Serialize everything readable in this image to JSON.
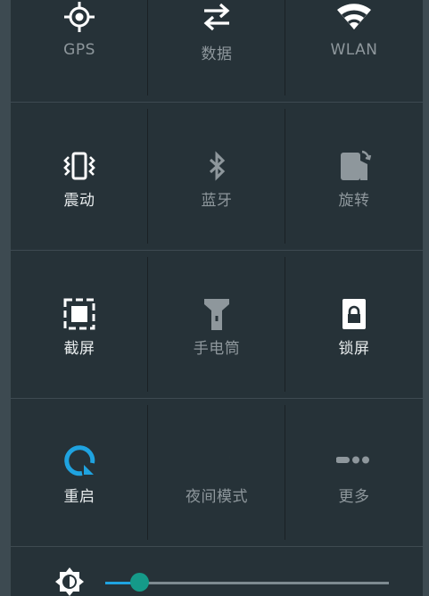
{
  "quick_settings": {
    "rows": [
      [
        {
          "label": "GPS",
          "icon": "gps-icon",
          "state": "off"
        },
        {
          "label": "数据",
          "icon": "data-transfer-icon",
          "state": "off"
        },
        {
          "label": "WLAN",
          "icon": "wifi-icon",
          "state": "off"
        }
      ],
      [
        {
          "label": "震动",
          "icon": "vibrate-icon",
          "state": "on"
        },
        {
          "label": "蓝牙",
          "icon": "bluetooth-icon",
          "state": "off"
        },
        {
          "label": "旋转",
          "icon": "rotate-icon",
          "state": "off"
        }
      ],
      [
        {
          "label": "截屏",
          "icon": "screenshot-icon",
          "state": "on"
        },
        {
          "label": "手电筒",
          "icon": "flashlight-icon",
          "state": "off"
        },
        {
          "label": "锁屏",
          "icon": "lock-screen-icon",
          "state": "on"
        }
      ],
      [
        {
          "label": "重启",
          "icon": "restart-icon",
          "state": "accent"
        },
        {
          "label": "夜间模式",
          "icon": "night-mode-icon",
          "state": "off"
        },
        {
          "label": "更多",
          "icon": "more-icon",
          "state": "off"
        }
      ]
    ]
  },
  "brightness": {
    "icon": "brightness-icon",
    "level": 0.12
  },
  "colors": {
    "background": "#263238",
    "active_icon": "#ffffff",
    "inactive_icon": "#8e979c",
    "accent": "#1fa3e0",
    "slider_thumb": "#159a89"
  }
}
